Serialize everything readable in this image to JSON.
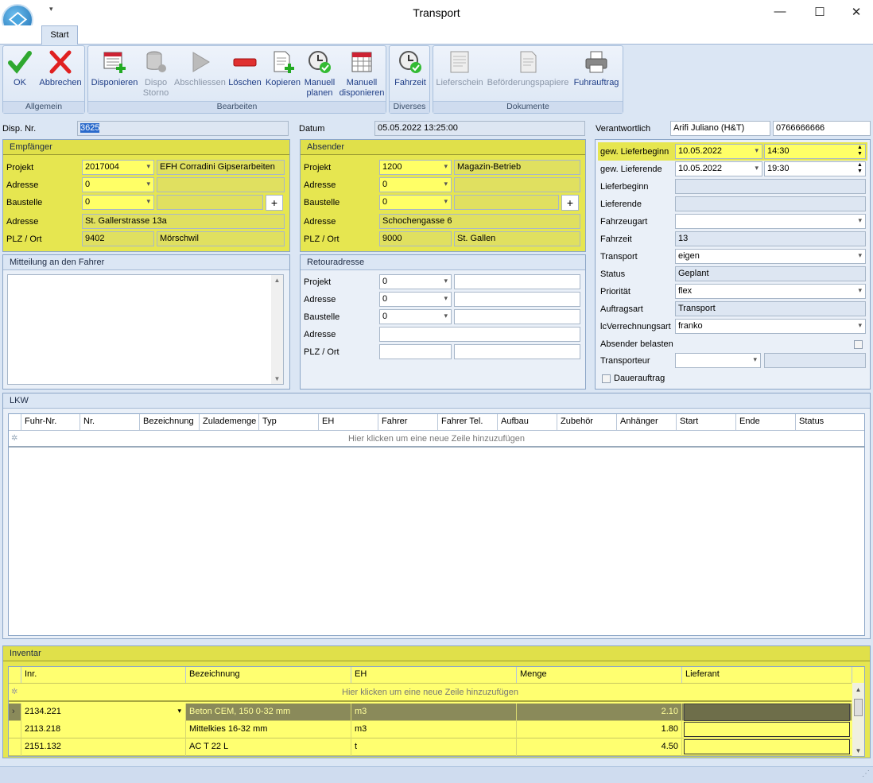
{
  "window": {
    "title": "Transport",
    "minimize": "—",
    "maximize": "☐",
    "close": "✕",
    "qat": "▾"
  },
  "ribbon": {
    "tab": "Start",
    "groups": [
      {
        "label": "Allgemein"
      },
      {
        "label": "Bearbeiten"
      },
      {
        "label": "Diverses"
      },
      {
        "label": "Dokumente"
      }
    ],
    "buttons": {
      "ok": "OK",
      "abbrechen": "Abbrechen",
      "disponieren": "Disponieren",
      "dispo_storno_1": "Dispo",
      "dispo_storno_2": "Storno",
      "abschliessen": "Abschliessen",
      "loeschen": "Löschen",
      "kopieren": "Kopieren",
      "manuell_planen_1": "Manuell",
      "manuell_planen_2": "planen",
      "manuell_disp_1": "Manuell",
      "manuell_disp_2": "disponieren",
      "fahrzeit": "Fahrzeit",
      "lieferschein": "Lieferschein",
      "befoerderung": "Beförderungspapiere",
      "fuhrauftrag": "Fuhrauftrag"
    }
  },
  "header": {
    "disp_nr_label": "Disp. Nr.",
    "disp_nr": "3625",
    "datum_label": "Datum",
    "datum": "05.05.2022 13:25:00",
    "verantwortlich_label": "Verantwortlich",
    "verantwortlich": "Arifi Juliano (H&T)",
    "telefon": "0766666666"
  },
  "empfaenger": {
    "title": "Empfänger",
    "projekt_label": "Projekt",
    "projekt": "2017004",
    "projekt_name": "EFH Corradini Gipserarbeiten",
    "adresse_label": "Adresse",
    "adresse": "0",
    "baustelle_label": "Baustelle",
    "baustelle": "0",
    "plus": "+",
    "adresse2_label": "Adresse",
    "strasse": "St. Gallerstrasse 13a",
    "plz_label": "PLZ / Ort",
    "plz": "9402",
    "ort": "Mörschwil"
  },
  "absender": {
    "title": "Absender",
    "projekt_label": "Projekt",
    "projekt": "1200",
    "projekt_name": "Magazin-Betrieb",
    "adresse_label": "Adresse",
    "adresse": "0",
    "baustelle_label": "Baustelle",
    "baustelle": "0",
    "plus": "+",
    "adresse2_label": "Adresse",
    "strasse": "Schochengasse 6",
    "plz_label": "PLZ / Ort",
    "plz": "9000",
    "ort": "St. Gallen"
  },
  "mitteilung": {
    "title": "Mitteilung an den Fahrer",
    "text": ""
  },
  "retour": {
    "title": "Retouradresse",
    "projekt_label": "Projekt",
    "projekt": "0",
    "adresse_label": "Adresse",
    "adresse": "0",
    "baustelle_label": "Baustelle",
    "baustelle": "0",
    "adresse2_label": "Adresse",
    "plz_label": "PLZ / Ort"
  },
  "details": {
    "gew_lieferbeginn_label": "gew. Lieferbeginn",
    "gew_lieferbeginn_date": "10.05.2022",
    "gew_lieferbeginn_time": "14:30",
    "gew_lieferende_label": "gew. Lieferende",
    "gew_lieferende_date": "10.05.2022",
    "gew_lieferende_time": "19:30",
    "lieferbeginn_label": "Lieferbeginn",
    "lieferende_label": "Lieferende",
    "fahrzeugart_label": "Fahrzeugart",
    "fahrzeit_label": "Fahrzeit",
    "fahrzeit": "13",
    "transport_label": "Transport",
    "transport": "eigen",
    "status_label": "Status",
    "status": "Geplant",
    "prioritaet_label": "Priorität",
    "prioritaet": "flex",
    "auftragsart_label": "Auftragsart",
    "auftragsart": "Transport",
    "verrechnung_label": "lcVerrechnungsart",
    "verrechnung": "franko",
    "absender_belasten_label": "Absender belasten",
    "transporteur_label": "Transporteur",
    "dauerauftrag_label": "Dauerauftrag"
  },
  "lkw": {
    "title": "LKW",
    "columns": [
      "Fuhr-Nr.",
      "Nr.",
      "Bezeichnung",
      "Zulademenge",
      "Typ",
      "EH",
      "Fahrer",
      "Fahrer Tel.",
      "Aufbau",
      "Zubehör",
      "Anhänger",
      "Start",
      "Ende",
      "Status"
    ],
    "new_row": "Hier klicken um eine neue Zeile hinzuzufügen"
  },
  "inventar": {
    "title": "Inventar",
    "columns": [
      "Inr.",
      "Bezeichnung",
      "EH",
      "Menge",
      "Lieferant"
    ],
    "new_row": "Hier klicken um eine neue Zeile hinzuzufügen",
    "rows": [
      {
        "inr": "2134.221",
        "bezeichnung": "Beton CEM, 150  0-32 mm",
        "eh": "m3",
        "menge": "2.10"
      },
      {
        "inr": "2113.218",
        "bezeichnung": "Mittelkies 16-32 mm",
        "eh": "m3",
        "menge": "1.80"
      },
      {
        "inr": "2151.132",
        "bezeichnung": "AC T 22 L",
        "eh": "t",
        "menge": "4.50"
      }
    ]
  },
  "colors": {
    "highlight": "#e6e650",
    "ribbon": "#dbe6f4",
    "accent": "#1e3d86"
  }
}
